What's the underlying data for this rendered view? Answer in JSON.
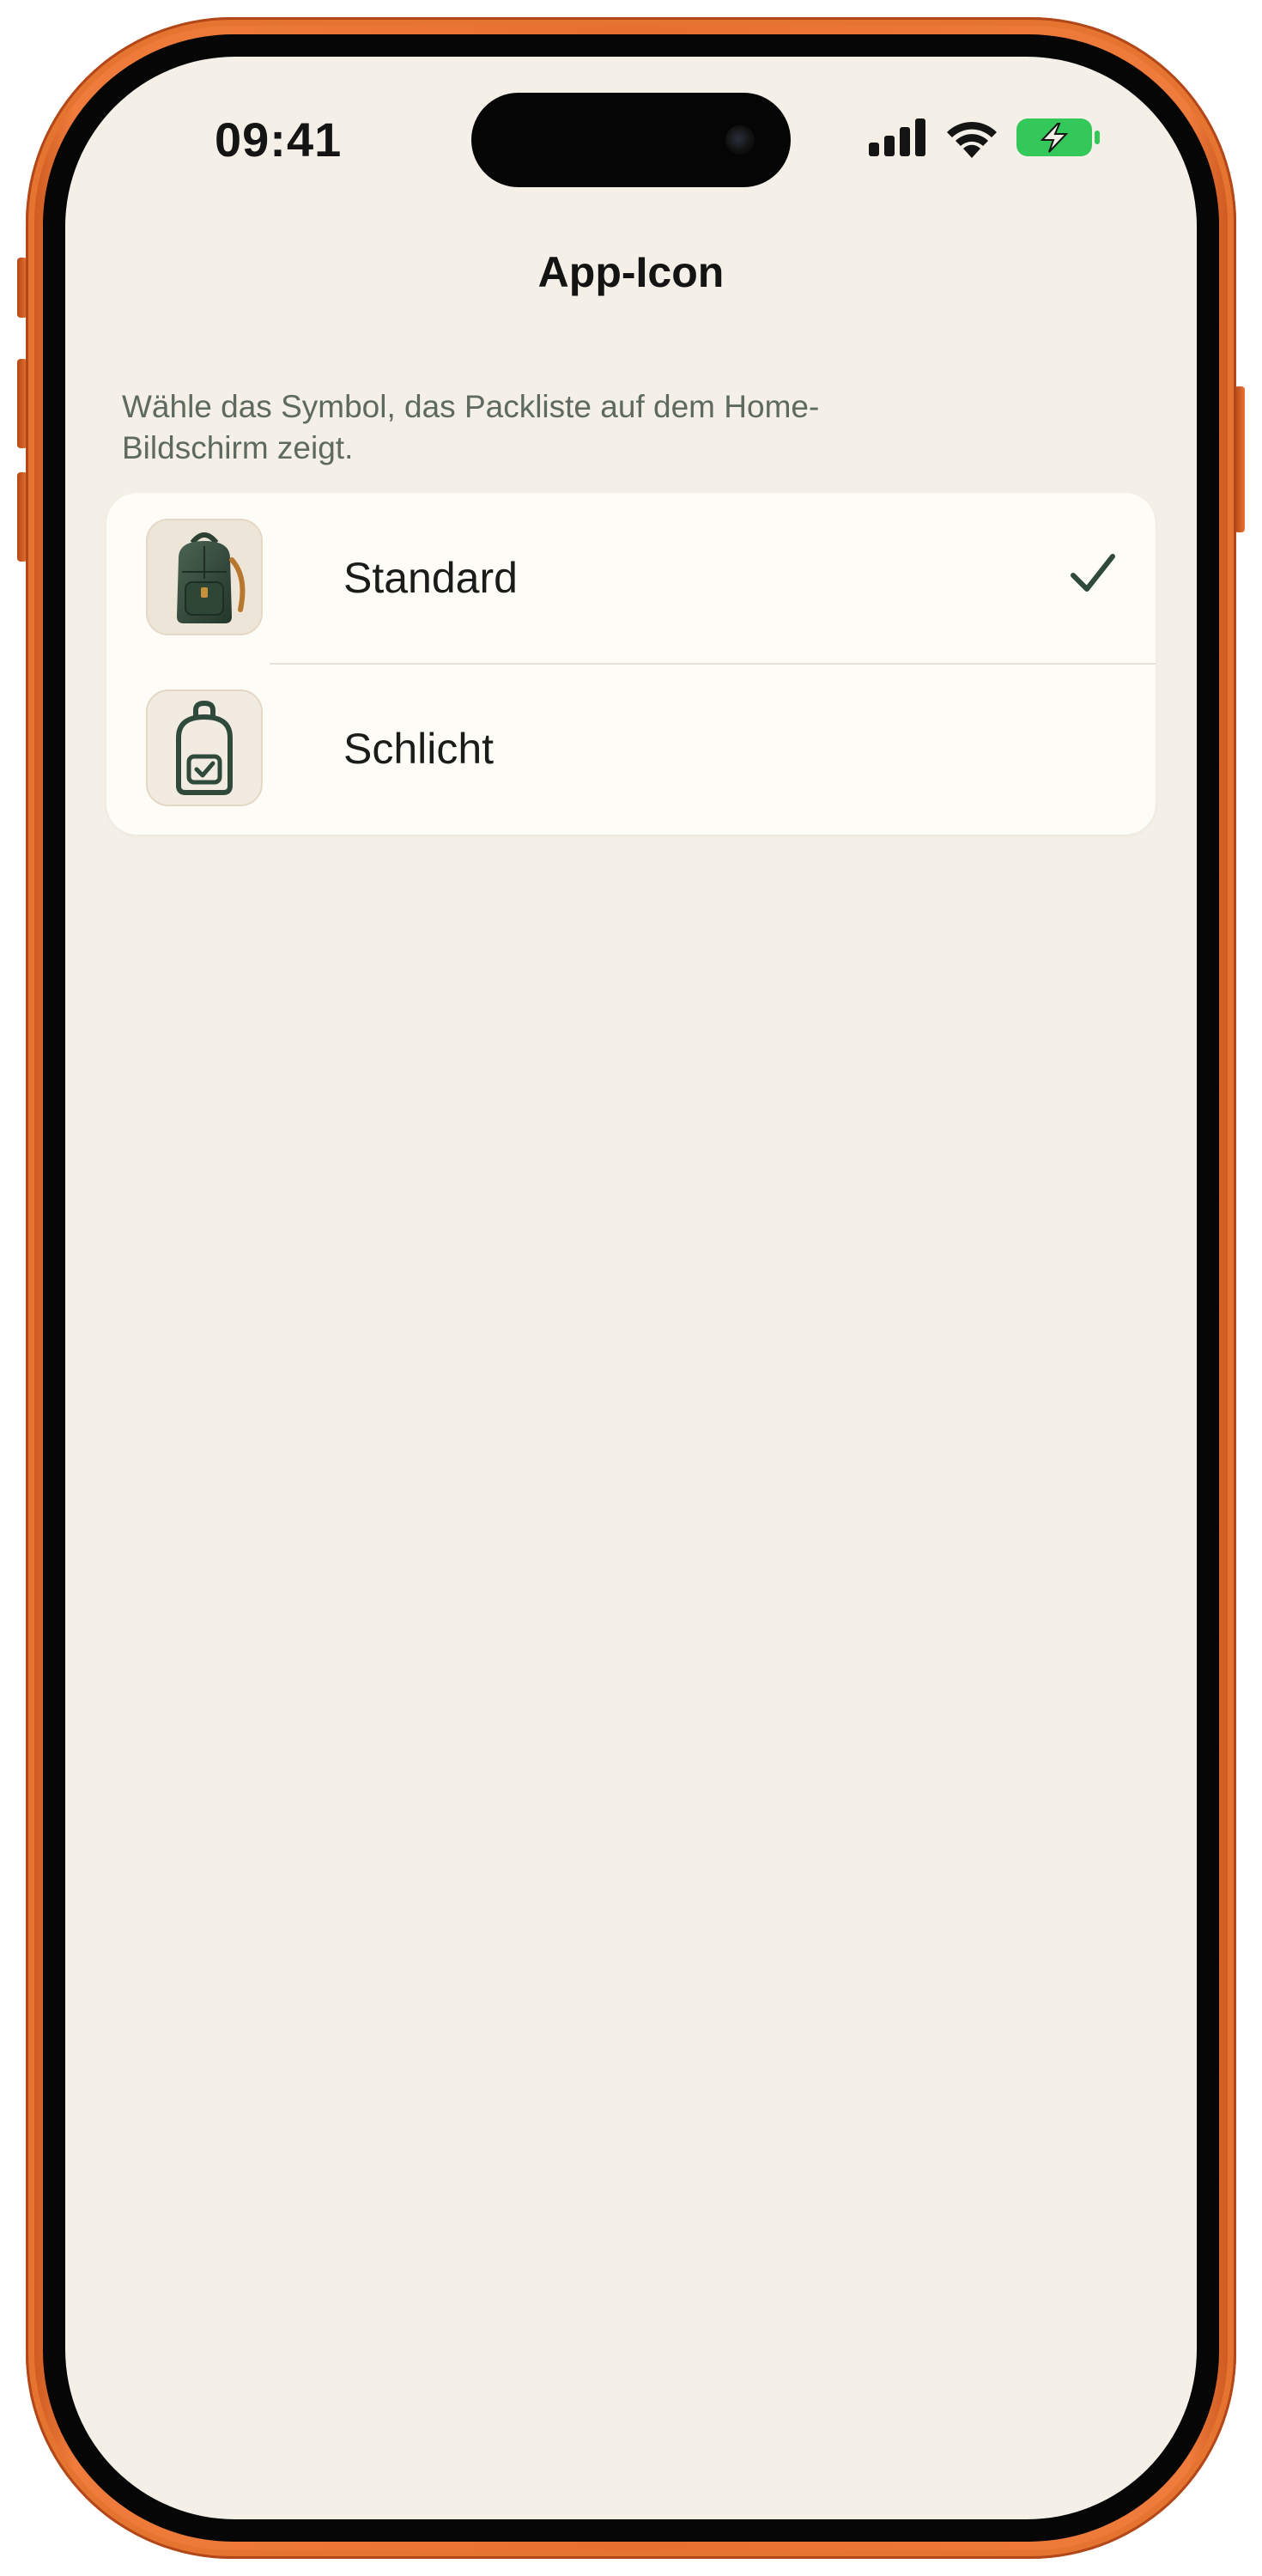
{
  "status_bar": {
    "time": "09:41",
    "battery_color": "#34c759",
    "icons": [
      "signal-icon",
      "wifi-icon",
      "battery-charging-icon"
    ]
  },
  "nav": {
    "title": "App-Icon"
  },
  "section": {
    "footer_line1": "Wähle das Symbol, das Packliste auf dem Home-",
    "footer_line2": "Bildschirm zeigt."
  },
  "icon_options": [
    {
      "label": "Standard",
      "icon": "backpack-color-icon",
      "selected": true
    },
    {
      "label": "Schlicht",
      "icon": "backpack-outline-icon",
      "selected": false
    }
  ],
  "colors": {
    "background": "#f4f0e7",
    "card": "#fdfcf7",
    "accent_green": "#2f4a3b",
    "frame_orange": "#e8702e"
  }
}
